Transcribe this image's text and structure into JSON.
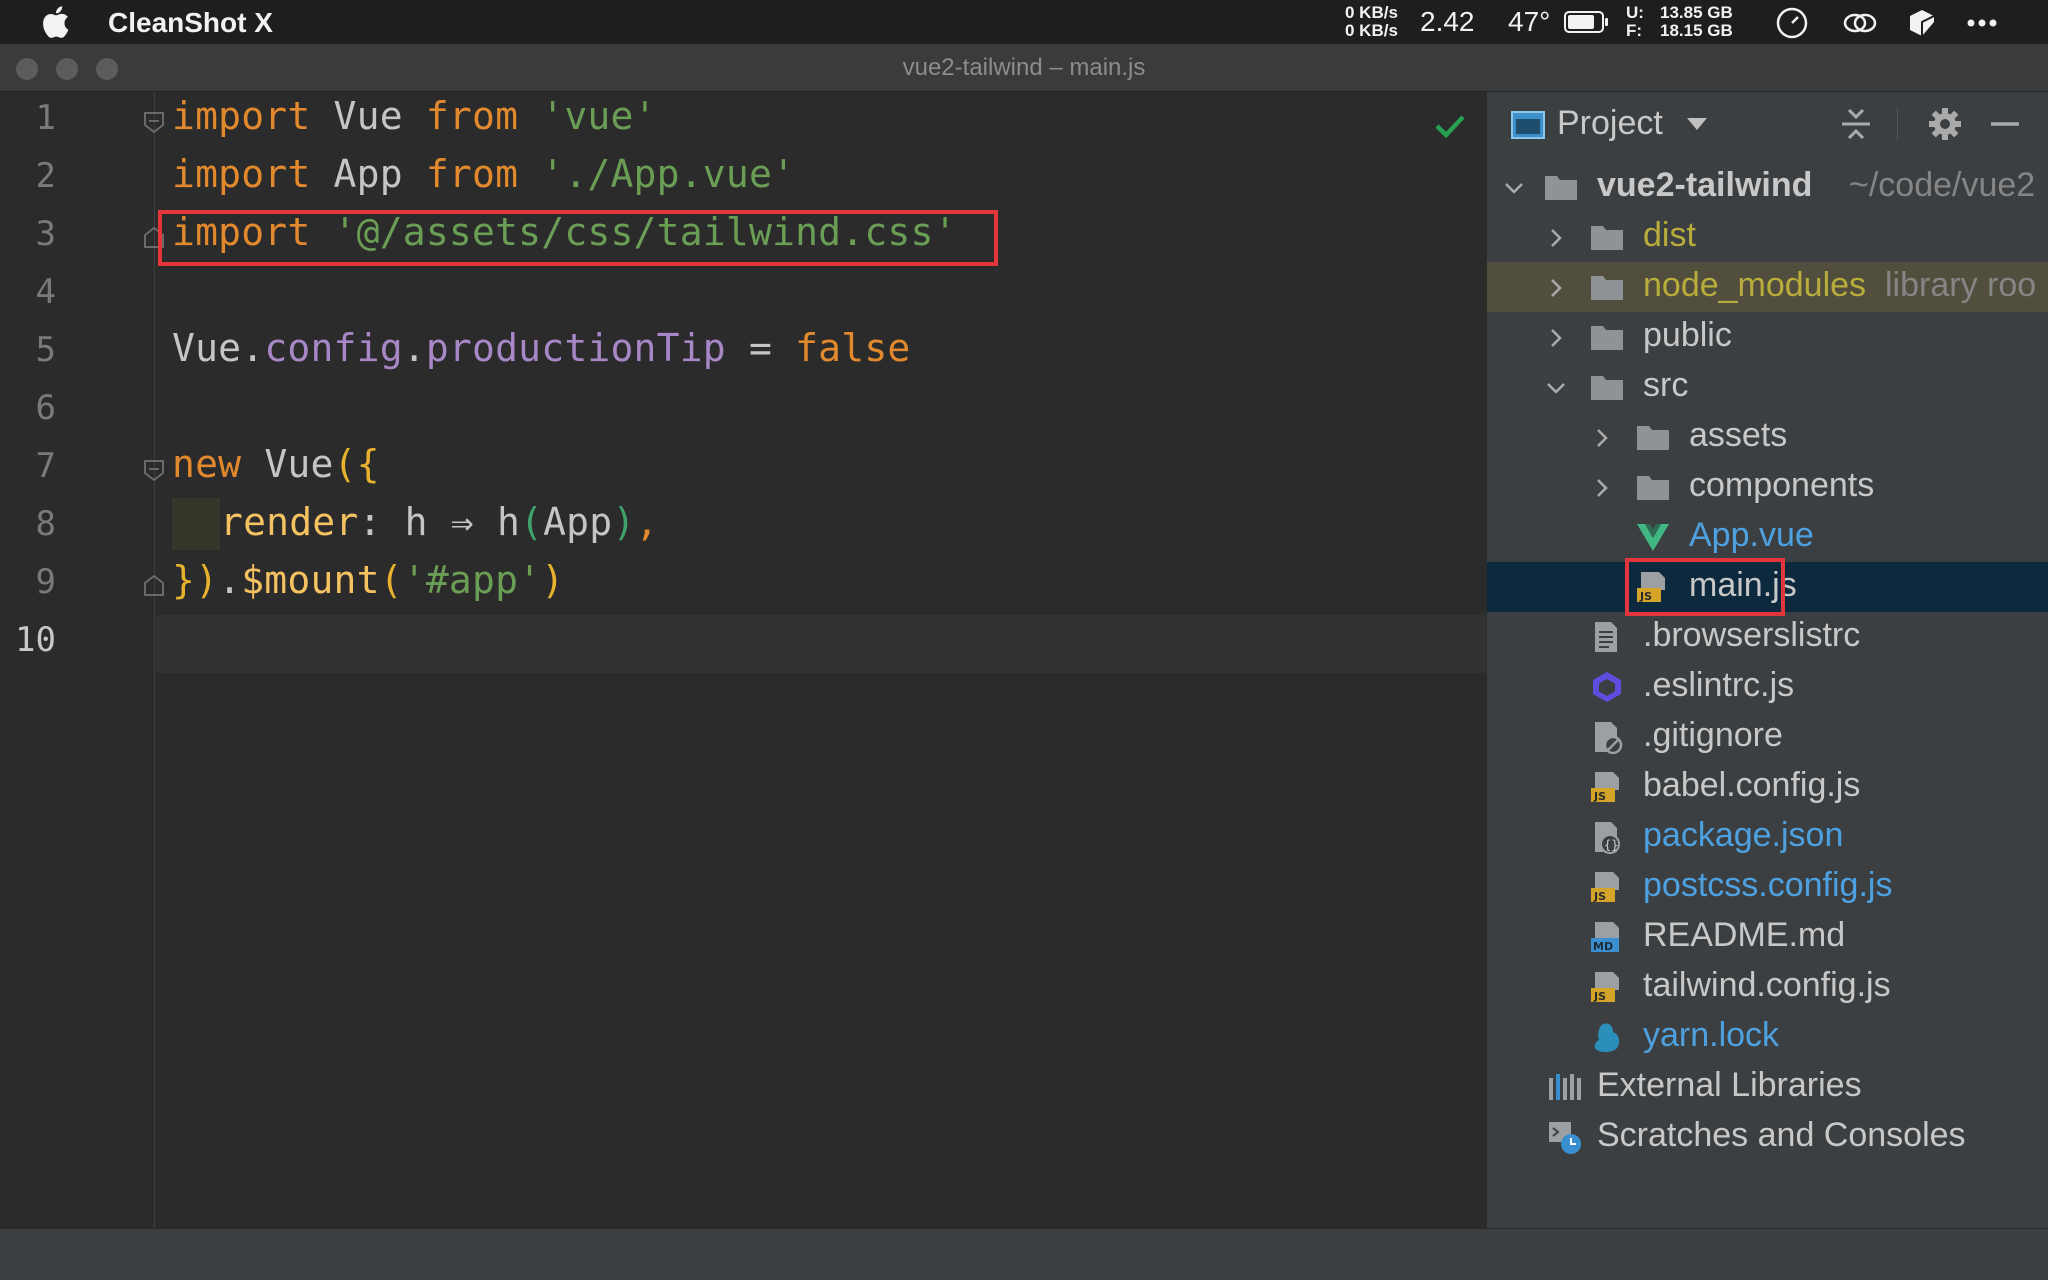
{
  "menubar": {
    "app_name": "CleanShot X",
    "net_up": "0 KB/s",
    "net_down": "0 KB/s",
    "load": "2.42",
    "temperature": "47°",
    "disk_used_key": "U:",
    "disk_free_key": "F:",
    "disk_used": "13.85 GB",
    "disk_free": "18.15 GB"
  },
  "window": {
    "title": "vue2-tailwind – main.js"
  },
  "editor": {
    "line_numbers": [
      "1",
      "2",
      "3",
      "4",
      "5",
      "6",
      "7",
      "8",
      "9",
      "10"
    ],
    "active_line": "10",
    "tokens": {
      "import": "import",
      "from": "from",
      "vue_ident": "Vue",
      "app_ident": "App",
      "str_vue": "'vue'",
      "str_app": "'./App.vue'",
      "str_tailwind": "'@/assets/css/tailwind.css'",
      "dot": ".",
      "config": "config",
      "productionTip": "productionTip",
      "equals": " = ",
      "false": "false",
      "new": "new",
      "open_paren": "(",
      "open_brace": "{",
      "render": "render",
      "colon": ": ",
      "h": "h",
      "arrow": " ⇒ ",
      "h_call": "h",
      "comma": ",",
      "close_brace": "}",
      "close_paren": ")",
      "mount": "$mount",
      "str_app_id": "'#app'",
      "space": " "
    },
    "highlighted_line": "3",
    "inspection_status": "no problems"
  },
  "project_panel": {
    "title": "Project",
    "root": {
      "name": "vue2-tailwind",
      "path": "~/code/vue2"
    },
    "items": [
      {
        "label": "dist",
        "type": "folder",
        "state": "collapsed",
        "style": "olive"
      },
      {
        "label": "node_modules",
        "hint": "library roo",
        "type": "folder",
        "state": "collapsed",
        "style": "olive"
      },
      {
        "label": "public",
        "type": "folder",
        "state": "collapsed",
        "style": "normal"
      },
      {
        "label": "src",
        "type": "folder",
        "state": "expanded",
        "style": "normal"
      },
      {
        "label": "assets",
        "type": "folder",
        "state": "collapsed",
        "style": "normal"
      },
      {
        "label": "components",
        "type": "folder",
        "state": "collapsed",
        "style": "normal"
      },
      {
        "label": "App.vue",
        "type": "vue",
        "style": "blue"
      },
      {
        "label": "main.js",
        "type": "js",
        "style": "normal",
        "selected": true
      },
      {
        "label": ".browserslistrc",
        "type": "text",
        "style": "normal"
      },
      {
        "label": ".eslintrc.js",
        "type": "eslint",
        "style": "normal"
      },
      {
        "label": ".gitignore",
        "type": "ignore",
        "style": "normal"
      },
      {
        "label": "babel.config.js",
        "type": "js",
        "style": "normal"
      },
      {
        "label": "package.json",
        "type": "json",
        "style": "blue"
      },
      {
        "label": "postcss.config.js",
        "type": "js",
        "style": "blue"
      },
      {
        "label": "README.md",
        "type": "md",
        "style": "normal"
      },
      {
        "label": "tailwind.config.js",
        "type": "js",
        "style": "normal"
      },
      {
        "label": "yarn.lock",
        "type": "yarn",
        "style": "blue"
      },
      {
        "label": "External Libraries",
        "type": "libraries",
        "style": "normal"
      },
      {
        "label": "Scratches and Consoles",
        "type": "scratches",
        "style": "normal"
      }
    ],
    "icons": {
      "header": "project-view-icon",
      "collapse": "collapse-all-icon",
      "settings": "gear-icon",
      "hide": "minimize-icon"
    },
    "colors": {
      "selected_row": "#0d293e",
      "excluded_row": "#514e3d",
      "highlight_box": "#e3363c"
    }
  }
}
